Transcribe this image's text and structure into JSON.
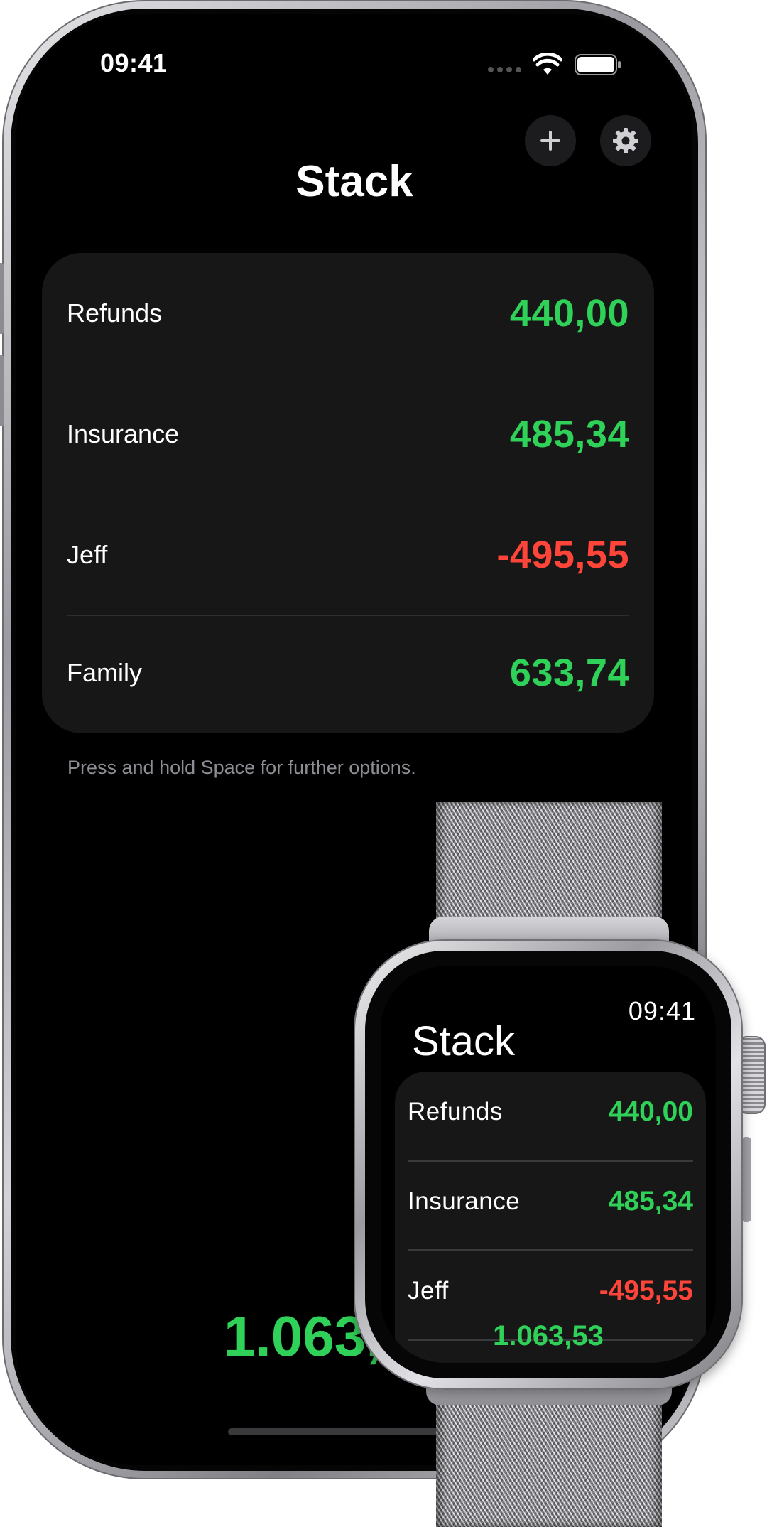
{
  "phone": {
    "status_bar": {
      "time": "09:41"
    },
    "title": "Stack",
    "items": [
      {
        "label": "Refunds",
        "amount": "440,00",
        "color": "#30d158"
      },
      {
        "label": "Insurance",
        "amount": "485,34",
        "color": "#30d158"
      },
      {
        "label": "Jeff",
        "amount": "-495,55",
        "color": "#ff453a"
      },
      {
        "label": "Family",
        "amount": "633,74",
        "color": "#30d158"
      }
    ],
    "hint": "Press and hold Space for further options.",
    "total_partial": "1.063,",
    "icons": {
      "add": "plus-icon",
      "settings": "gear-icon"
    }
  },
  "watch": {
    "time": "09:41",
    "title": "Stack",
    "items": [
      {
        "label": "Refunds",
        "amount": "440,00"
      },
      {
        "label": "Insurance",
        "amount": "485,34"
      },
      {
        "label": "Jeff",
        "amount": "-495,55"
      }
    ],
    "total": "1.063,53"
  },
  "colors": {
    "positive": "#30d158",
    "negative": "#ff453a",
    "background": "#000000",
    "card": "#171717"
  }
}
